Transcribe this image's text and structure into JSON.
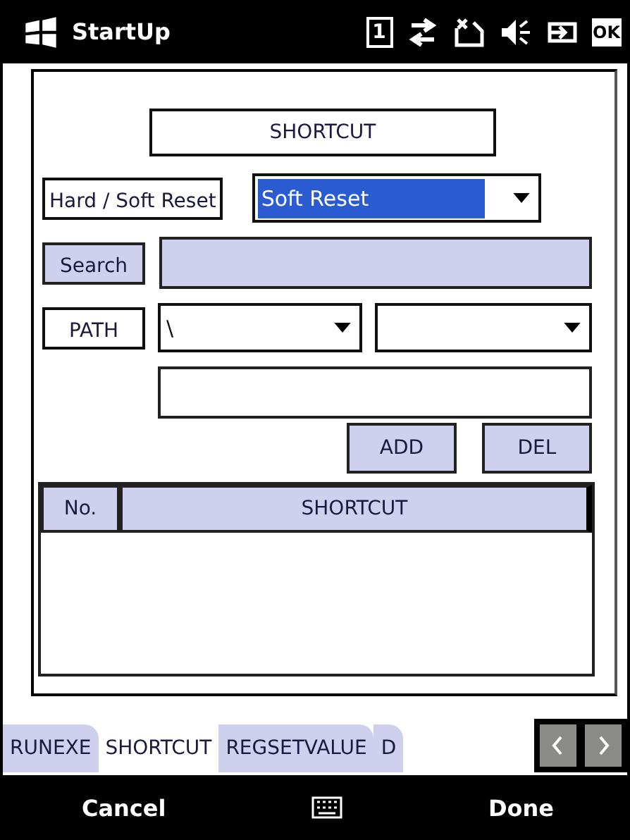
{
  "title_bar": {
    "title": "StartUp",
    "slot_indicator": "1",
    "ok_button": "OK"
  },
  "form": {
    "heading": "SHORTCUT",
    "reset_label": "Hard / Soft Reset",
    "reset_select": {
      "value": "Soft Reset",
      "selected": true
    },
    "search_button": "Search",
    "path_label": "PATH",
    "path_select": {
      "value": "\\"
    },
    "buttons": [
      "ADD",
      "DEL"
    ],
    "table": {
      "columns": [
        "No.",
        "SHORTCUT"
      ]
    }
  },
  "tabs": [
    {
      "label": "RUNEXE",
      "selected": false
    },
    {
      "label": "SHORTCUT",
      "selected": true
    },
    {
      "label": "REGSETVALUE",
      "selected": false
    },
    {
      "label": "D",
      "selected": false
    }
  ],
  "softkeys": {
    "left": "Cancel",
    "right": "Done"
  }
}
